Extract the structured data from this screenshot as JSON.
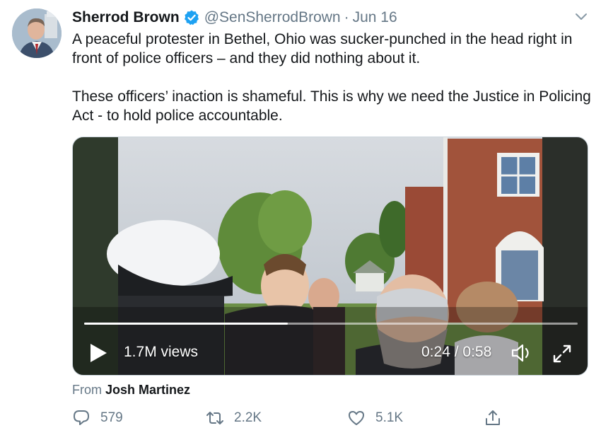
{
  "tweet": {
    "author_name": "Sherrod Brown",
    "handle": "@SenSherrodBrown",
    "separator": "·",
    "date": "Jun 16",
    "text_paragraph_1": "A peaceful protester in Bethel, Ohio was sucker-punched in the head right in front of police officers – and they did nothing about it.",
    "text_paragraph_2": "These officers’ inaction is shameful. This is why we need the Justice in Policing Act - to hold police accountable."
  },
  "video": {
    "views": "1.7M views",
    "current_time": "0:24",
    "time_separator": "/",
    "duration": "0:58",
    "progress_fraction": 0.413
  },
  "attribution": {
    "prefix": "From",
    "source_name": "Josh Martinez"
  },
  "actions": {
    "reply_count": "579",
    "retweet_count": "2.2K",
    "like_count": "5.1K"
  },
  "icons": {
    "verified": "verified-badge-icon",
    "caret": "chevron-down-icon",
    "play": "play-icon",
    "volume": "volume-icon",
    "fullscreen": "fullscreen-icon",
    "reply": "reply-icon",
    "retweet": "retweet-icon",
    "like": "heart-icon",
    "share": "share-icon"
  },
  "colors": {
    "verified_blue": "#1da1f2",
    "secondary_text": "#657786",
    "primary_text": "#14171a"
  }
}
